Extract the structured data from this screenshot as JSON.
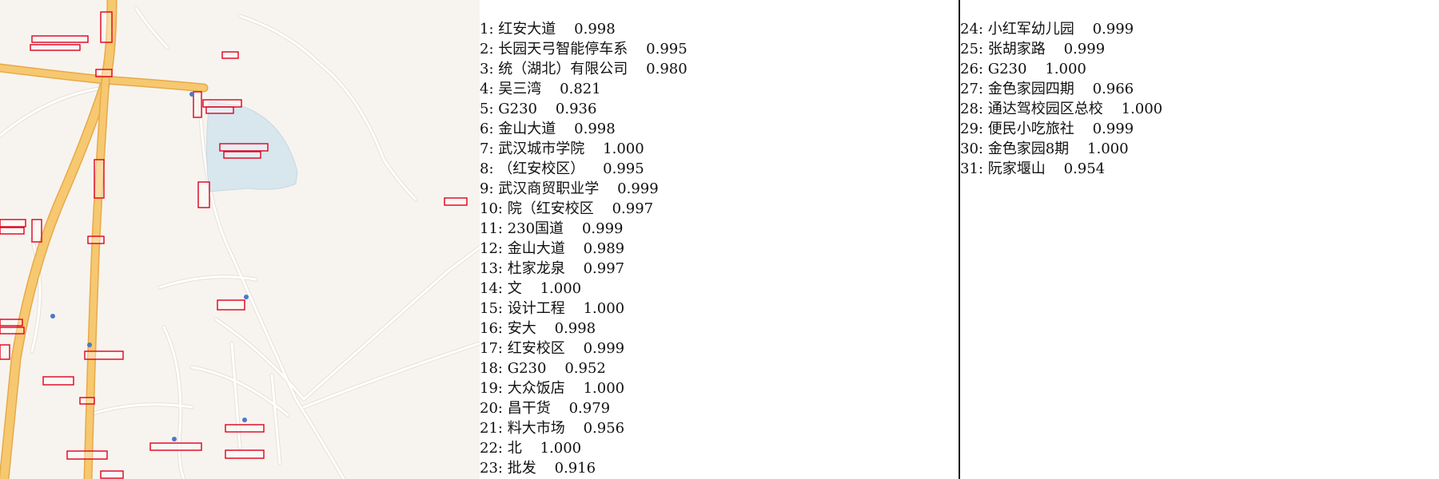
{
  "colors": {
    "map_bg": "#f7f4ef",
    "highway": "#f6c870",
    "highway_edge": "#e8a94a",
    "secondary_road": "#f1e9a8",
    "minor_road": "#ffffff",
    "water": "#d8e6ee",
    "box": "#e0001b",
    "text": "#111111",
    "divider": "#111111"
  },
  "results": [
    {
      "idx": "1",
      "text": "红安大道",
      "score": "0.998"
    },
    {
      "idx": "2",
      "text": "长园天弓智能停车系",
      "score": "0.995"
    },
    {
      "idx": "3",
      "text": "统（湖北）有限公司",
      "score": "0.980"
    },
    {
      "idx": "4",
      "text": "吴三湾",
      "score": "0.821"
    },
    {
      "idx": "5",
      "text": "G230",
      "score": "0.936"
    },
    {
      "idx": "6",
      "text": "金山大道",
      "score": "0.998"
    },
    {
      "idx": "7",
      "text": "武汉城市学院",
      "score": "1.000"
    },
    {
      "idx": "8",
      "text": "（红安校区）",
      "score": "0.995"
    },
    {
      "idx": "9",
      "text": "武汉商贸职业学",
      "score": "0.999"
    },
    {
      "idx": "10",
      "text": "院（红安校区",
      "score": "0.997"
    },
    {
      "idx": "11",
      "text": "230国道",
      "score": "0.999"
    },
    {
      "idx": "12",
      "text": "金山大道",
      "score": "0.989"
    },
    {
      "idx": "13",
      "text": "杜家龙泉",
      "score": "0.997"
    },
    {
      "idx": "14",
      "text": "文",
      "score": "1.000"
    },
    {
      "idx": "15",
      "text": "设计工程",
      "score": "1.000"
    },
    {
      "idx": "16",
      "text": "安大",
      "score": "0.998"
    },
    {
      "idx": "17",
      "text": "红安校区",
      "score": "0.999"
    },
    {
      "idx": "18",
      "text": "G230",
      "score": "0.952"
    },
    {
      "idx": "19",
      "text": "大众饭店",
      "score": "1.000"
    },
    {
      "idx": "20",
      "text": "昌干货",
      "score": "0.979"
    },
    {
      "idx": "21",
      "text": "料大市场",
      "score": "0.956"
    },
    {
      "idx": "22",
      "text": "北",
      "score": "1.000"
    },
    {
      "idx": "23",
      "text": "批发",
      "score": "0.916"
    },
    {
      "idx": "24",
      "text": "小红军幼儿园",
      "score": "0.999"
    },
    {
      "idx": "25",
      "text": "张胡家路",
      "score": "0.999"
    },
    {
      "idx": "26",
      "text": "G230",
      "score": "1.000"
    },
    {
      "idx": "27",
      "text": "金色家园四期",
      "score": "0.966"
    },
    {
      "idx": "28",
      "text": "通达驾校园区总校",
      "score": "1.000"
    },
    {
      "idx": "29",
      "text": "便民小吃旅社",
      "score": "0.999"
    },
    {
      "idx": "30",
      "text": "金色家园8期",
      "score": "1.000"
    },
    {
      "idx": "31",
      "text": "阮家堰山",
      "score": "0.954"
    }
  ]
}
